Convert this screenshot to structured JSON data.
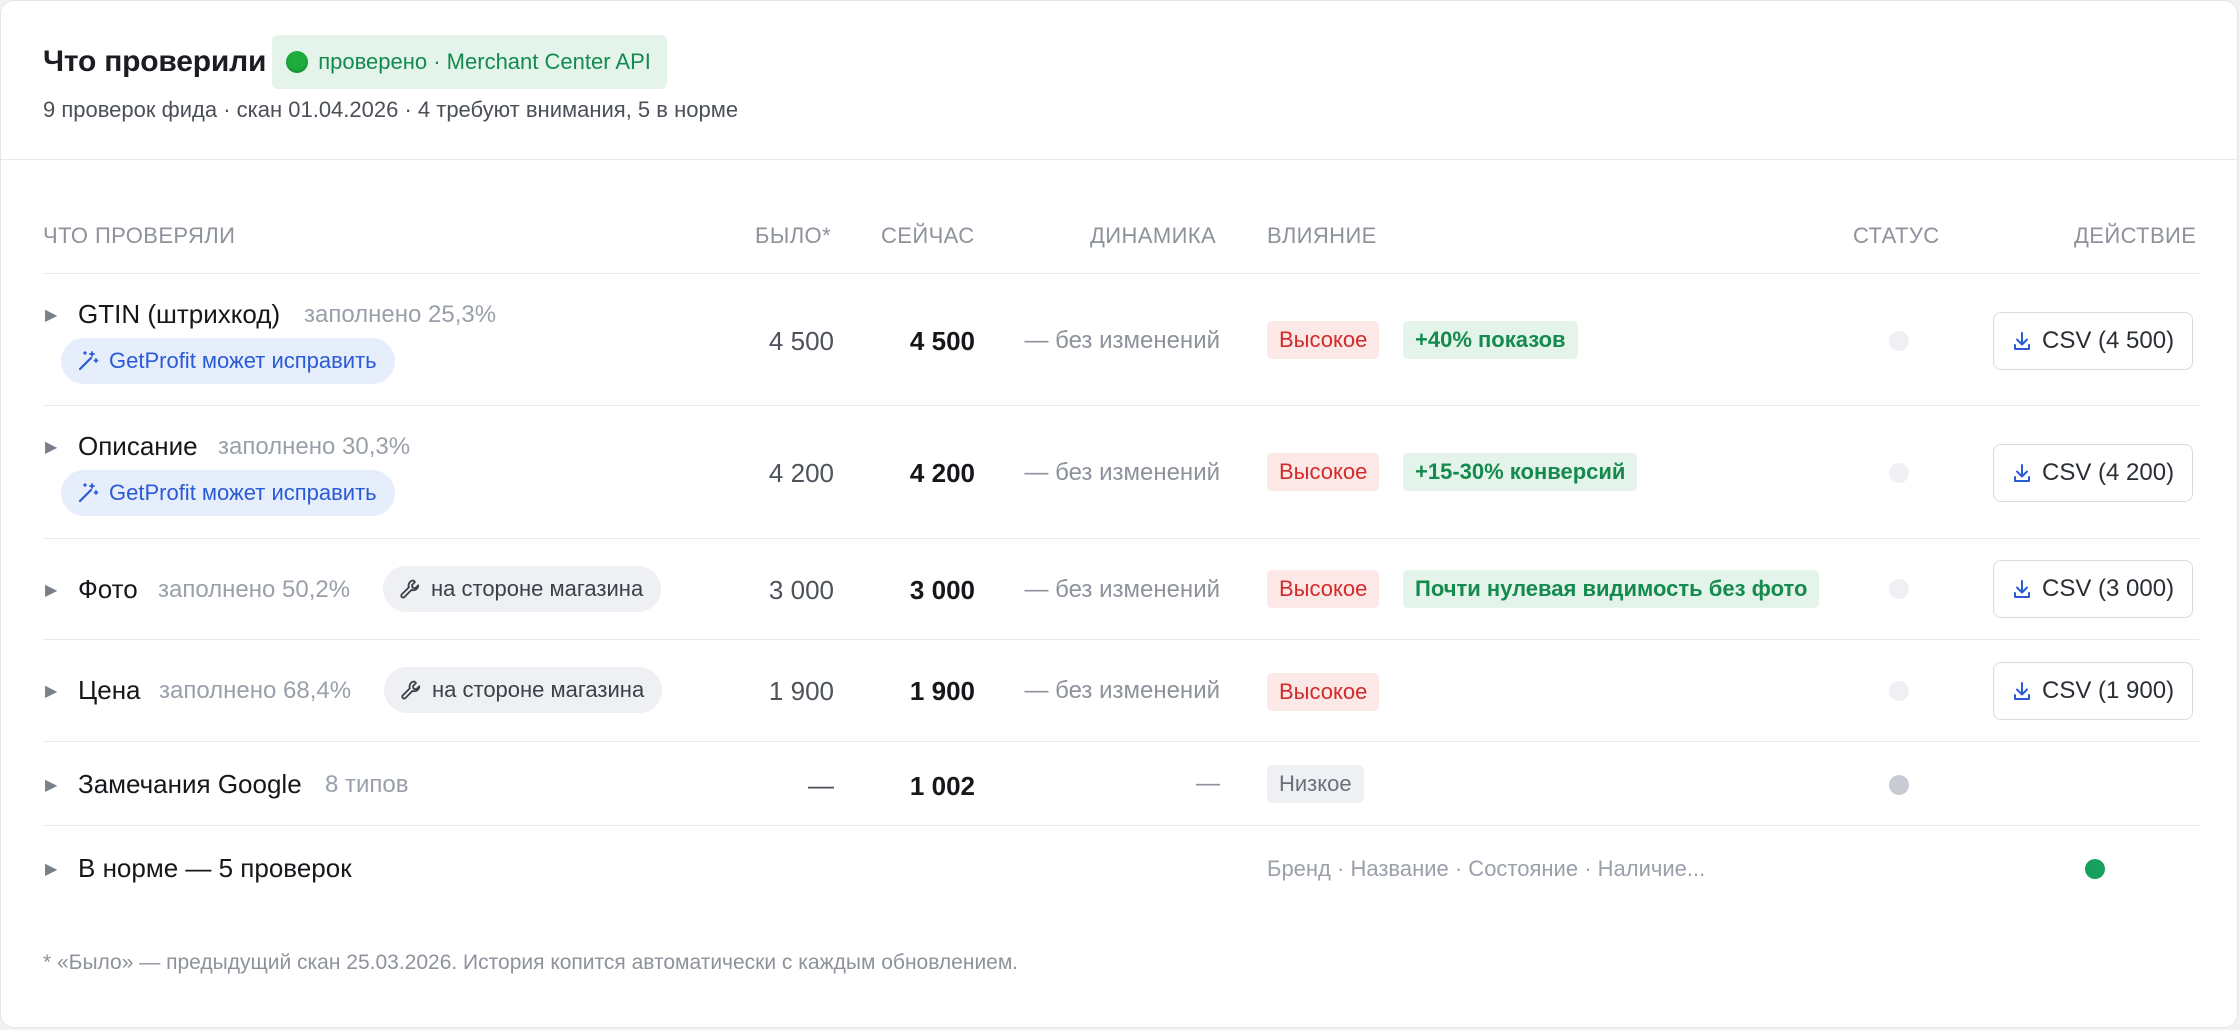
{
  "header": {
    "title": "Что проверили",
    "verified_label": "проверено · Merchant Center API",
    "subtitle": "9 проверок фида · скан 01.04.2026 · 4 требуют внимания, 5 в норме"
  },
  "columns": {
    "what": "ЧТО ПРОВЕРЯЛИ",
    "was": "БЫЛО*",
    "now": "СЕЙЧАС",
    "dynamics": "ДИНАМИКА",
    "impact": "ВЛИЯНИЕ",
    "status": "СТАТУС",
    "action": "ДЕЙСТВИЕ"
  },
  "rows": [
    {
      "name": "GTIN (штрихкод)",
      "fill": "заполнено 25,3%",
      "pill": "GetProfit может исправить",
      "was": "4 500",
      "now": "4 500",
      "dynamics": "— без изменений",
      "impact": "Высокое",
      "gain": "+40% показов",
      "action": "CSV (4 500)"
    },
    {
      "name": "Описание",
      "fill": "заполнено 30,3%",
      "pill": "GetProfit может исправить",
      "was": "4 200",
      "now": "4 200",
      "dynamics": "— без изменений",
      "impact": "Высокое",
      "gain": "+15-30% конверсий",
      "action": "CSV (4 200)"
    },
    {
      "name": "Фото",
      "fill": "заполнено 50,2%",
      "pill": "на стороне магазина",
      "was": "3 000",
      "now": "3 000",
      "dynamics": "— без изменений",
      "impact": "Высокое",
      "gain": "Почти нулевая видимость без фото",
      "action": "CSV (3 000)"
    },
    {
      "name": "Цена",
      "fill": "заполнено 68,4%",
      "pill": "на стороне магазина",
      "was": "1 900",
      "now": "1 900",
      "dynamics": "— без изменений",
      "impact": "Высокое",
      "action": "CSV (1 900)"
    },
    {
      "name": "Замечания Google",
      "fill": "8 типов",
      "was": "—",
      "now": "1 002",
      "dynamics": "—",
      "impact": "Низкое"
    },
    {
      "name": "В норме — 5 проверок",
      "impact_text": "Бренд · Название · Состояние · Наличие..."
    }
  ],
  "footnote": "* «Было» — предыдущий скан 25.03.2026. История копится автоматически с каждым обновлением.",
  "colors": {
    "high": "#d42a2a",
    "gain": "#158a4e",
    "fix": "#2a5bd7",
    "ok": "#18a05e"
  }
}
